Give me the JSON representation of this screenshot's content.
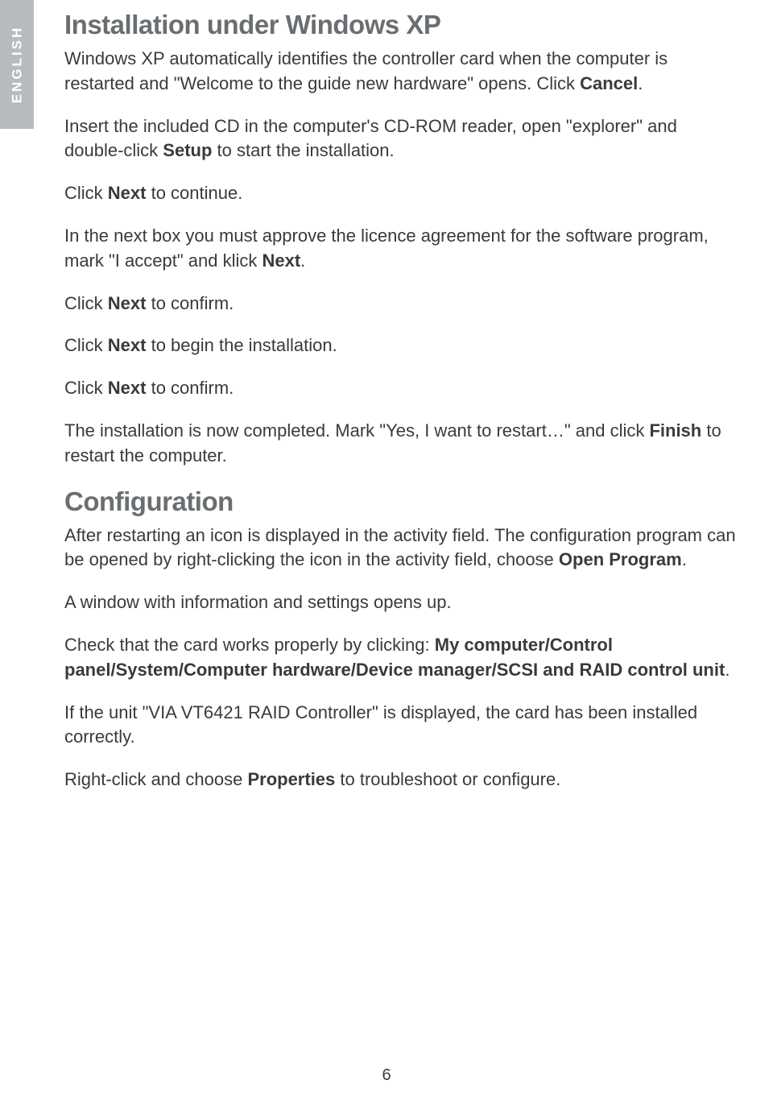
{
  "sideTab": "ENGLISH",
  "heading1": "Installation under Windows XP",
  "p1a": "Windows XP automatically identifies the controller card when the computer is restarted and \"Welcome to the guide new hardware\" opens. Click ",
  "p1b": "Cancel",
  "p1c": ".",
  "p2a": "Insert the included CD in the computer's CD-ROM reader, open \"explorer\" and double-click ",
  "p2b": "Setup",
  "p2c": " to start the installation.",
  "p3a": "Click ",
  "p3b": "Next",
  "p3c": " to continue.",
  "p4a": "In the next box you must approve the licence agreement for the software program, mark \"I accept\" and klick ",
  "p4b": "Next",
  "p4c": ".",
  "p5a": "Click ",
  "p5b": "Next",
  "p5c": " to confirm.",
  "p6a": "Click ",
  "p6b": "Next",
  "p6c": " to begin the installation.",
  "p7a": "Click ",
  "p7b": "Next",
  "p7c": " to confirm.",
  "p8a": "The installation is now completed. Mark \"Yes, I want to restart…\" and click ",
  "p8b": "Finish",
  "p8c": " to restart the computer.",
  "heading2": "Configuration",
  "p9a": "After restarting an icon is displayed in the activity field. The configuration program can be opened by right-clicking the icon in the activity field, choose ",
  "p9b": "Open Program",
  "p9c": ".",
  "p10": "A window with information and settings opens up.",
  "p11a": "Check that the card works properly by clicking: ",
  "p11b": "My computer/Control panel/System/Computer hardware/Device manager/SCSI and RAID control unit",
  "p11c": ".",
  "p12": "If the unit \"VIA VT6421 RAID Controller\" is displayed, the card has been installed correctly.",
  "p13a": "Right-click and choose ",
  "p13b": "Properties",
  "p13c": " to troubleshoot or configure.",
  "pageNumber": "6"
}
